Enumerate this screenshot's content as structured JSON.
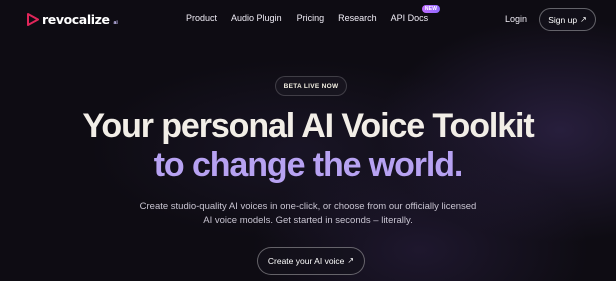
{
  "brand": {
    "name": "revocalize",
    "suffix": "ai",
    "accent": "#e0265a"
  },
  "nav": {
    "links": [
      "Product",
      "Audio Plugin",
      "Pricing",
      "Research",
      "API Docs"
    ],
    "api_badge": "NEW",
    "login": "Login",
    "signup": "Sign up",
    "signup_arrow": "↗"
  },
  "hero": {
    "badge": "BETA LIVE NOW",
    "title_line1": "Your personal AI Voice Toolkit",
    "title_line2": "to change the world.",
    "subtitle_line1": "Create studio-quality AI voices in one-click, or choose from our officially licensed",
    "subtitle_line2": "AI voice models. Get started in seconds – literally.",
    "cta": "Create your AI voice",
    "cta_arrow": "↗"
  },
  "colors": {
    "background": "#0e0c13",
    "title_primary": "#f2eee7",
    "title_accent": "#b7a2f2"
  }
}
